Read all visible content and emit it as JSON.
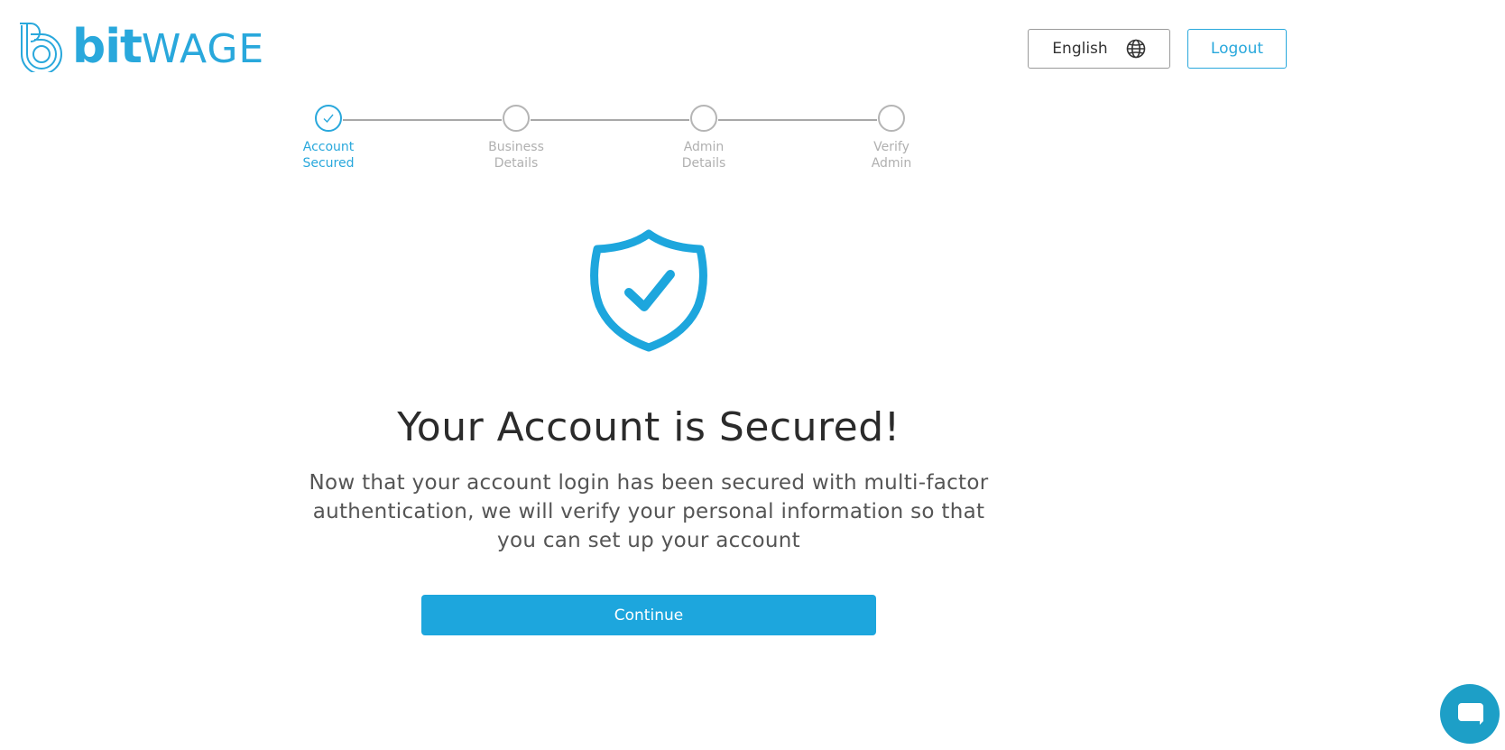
{
  "brand": {
    "logo_bit": "bit",
    "logo_wage": "WAGE",
    "color": "#29a8dc"
  },
  "header": {
    "language_label": "English",
    "language_icon": "globe-icon",
    "logout_label": "Logout"
  },
  "stepper": {
    "steps": [
      {
        "label": "Account\nSecured",
        "state": "completed"
      },
      {
        "label": "Business\nDetails",
        "state": "pending"
      },
      {
        "label": "Admin\nDetails",
        "state": "pending"
      },
      {
        "label": "Verify\nAdmin",
        "state": "pending"
      }
    ]
  },
  "main": {
    "icon": "shield-check-icon",
    "title": "Your Account is Secured!",
    "description": "Now that your account login has been secured with multi-factor authentication, we will verify your personal information so that you can set up your account",
    "continue_label": "Continue"
  },
  "chat": {
    "icon": "chat-bubble-icon"
  },
  "colors": {
    "accent": "#1da6dd",
    "text": "#2b2b2b",
    "muted": "#b0b0b0"
  }
}
